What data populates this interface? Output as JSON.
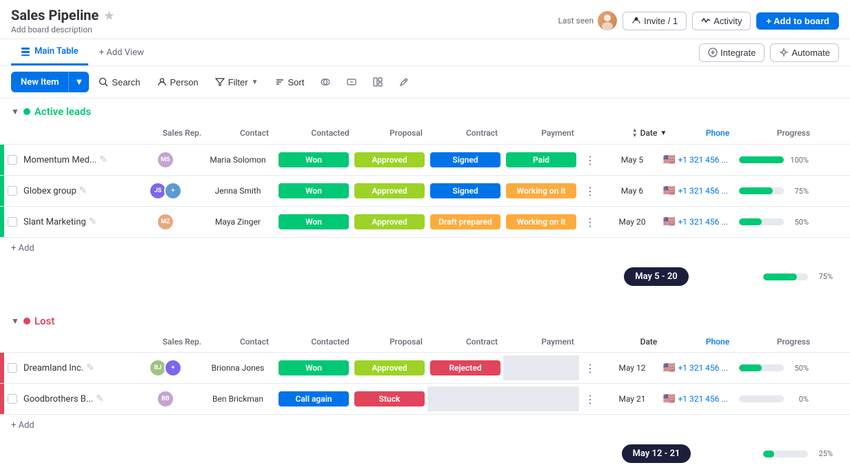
{
  "header": {
    "title": "Sales Pipeline",
    "description": "Add board description",
    "last_seen_label": "Last seen",
    "invite_label": "Invite / 1",
    "activity_label": "Activity",
    "add_to_board_label": "+ Add to board"
  },
  "views": {
    "main_table_label": "Main Table",
    "add_view_label": "+ Add View",
    "integrate_label": "Integrate",
    "automate_label": "Automate"
  },
  "toolbar": {
    "new_item_label": "New Item",
    "search_label": "Search",
    "person_label": "Person",
    "filter_label": "Filter",
    "sort_label": "Sort"
  },
  "columns": {
    "sales_rep": "Sales Rep.",
    "contact": "Contact",
    "contacted": "Contacted",
    "proposal": "Proposal",
    "contract": "Contract",
    "payment": "Payment",
    "date": "Date",
    "phone": "Phone",
    "progress": "Progress"
  },
  "groups": [
    {
      "id": "active",
      "name": "Active leads",
      "color": "green",
      "rows": [
        {
          "name": "Momentum Med...",
          "contacted": "Won",
          "proposal": "Approved",
          "contract": "Signed",
          "payment": "Paid",
          "payment_color": "green",
          "date": "May 5",
          "phone": "+1 321 456 ...",
          "progress": 100
        },
        {
          "name": "Globex group",
          "contacted": "Won",
          "proposal": "Approved",
          "contract": "Signed",
          "payment": "Working on it",
          "payment_color": "orange",
          "date": "May 6",
          "phone": "+1 321 456 ...",
          "progress": 75
        },
        {
          "name": "Slant Marketing",
          "contacted": "Won",
          "proposal": "Approved",
          "contract": "Draft prepared",
          "payment": "Working on it",
          "payment_color": "orange",
          "date": "May 20",
          "phone": "+1 321 456 ...",
          "progress": 50
        }
      ],
      "summary_date": "May 5 - 20",
      "summary_progress": 75
    },
    {
      "id": "lost",
      "name": "Lost",
      "color": "red",
      "rows": [
        {
          "name": "Dreamland Inc.",
          "contacted": "Won",
          "proposal": "Approved",
          "contract": "Rejected",
          "payment": "",
          "payment_color": "none",
          "date": "May 12",
          "phone": "+1 321 456 ...",
          "progress": 50
        },
        {
          "name": "Goodbrothers B...",
          "contacted": "Call again",
          "proposal": "Stuck",
          "contract": "",
          "payment": "",
          "payment_color": "none",
          "date": "May 21",
          "phone": "+1 321 456 ...",
          "progress": 0
        }
      ],
      "summary_date": "May 12 - 21",
      "summary_progress": 25
    }
  ]
}
